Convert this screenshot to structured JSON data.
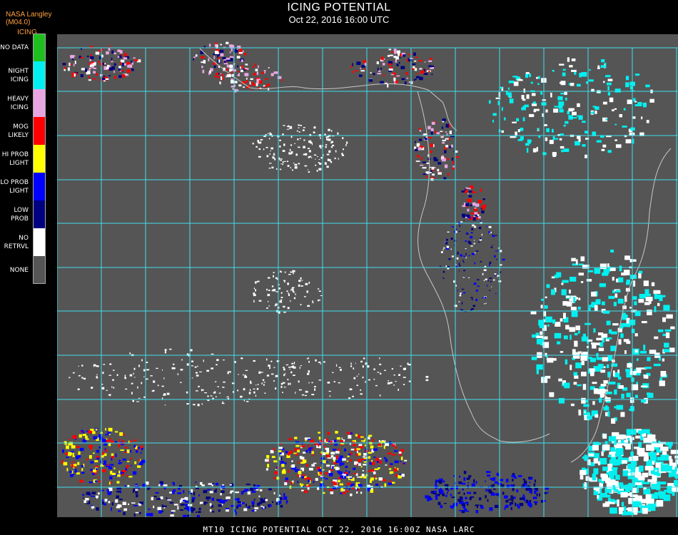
{
  "title": "ICING POTENTIAL",
  "subtitle": "Oct 22, 2016 16:00 UTC",
  "source_label": "NASA Langley (M04.0)",
  "product_label": "ICING",
  "legend": [
    {
      "label": "NO DATA",
      "color": "#1fbf1f"
    },
    {
      "label": "NIGHT\nICING",
      "color": "#00f0f0"
    },
    {
      "label": "HEAVY\nICING",
      "color": "#e8a6e0"
    },
    {
      "label": "MOG\nLIKELY",
      "color": "#ff0000"
    },
    {
      "label": "HI PROB\nLIGHT",
      "color": "#ffff00"
    },
    {
      "label": "LO PROB\nLIGHT",
      "color": "#0000ff"
    },
    {
      "label": "LOW\nPROB",
      "color": "#000080"
    },
    {
      "label": "NO\nRETRVL",
      "color": "#ffffff"
    },
    {
      "label": "NONE",
      "color": "#555555"
    }
  ],
  "footer": "MT10   ICING POTENTIAL    OCT 22, 2016 16:00Z   NASA LARC",
  "colors": {
    "background": "#555555",
    "grid": "#40e0f0",
    "boundary": "#c8c8c8",
    "grid_label": "#c0392b"
  }
}
